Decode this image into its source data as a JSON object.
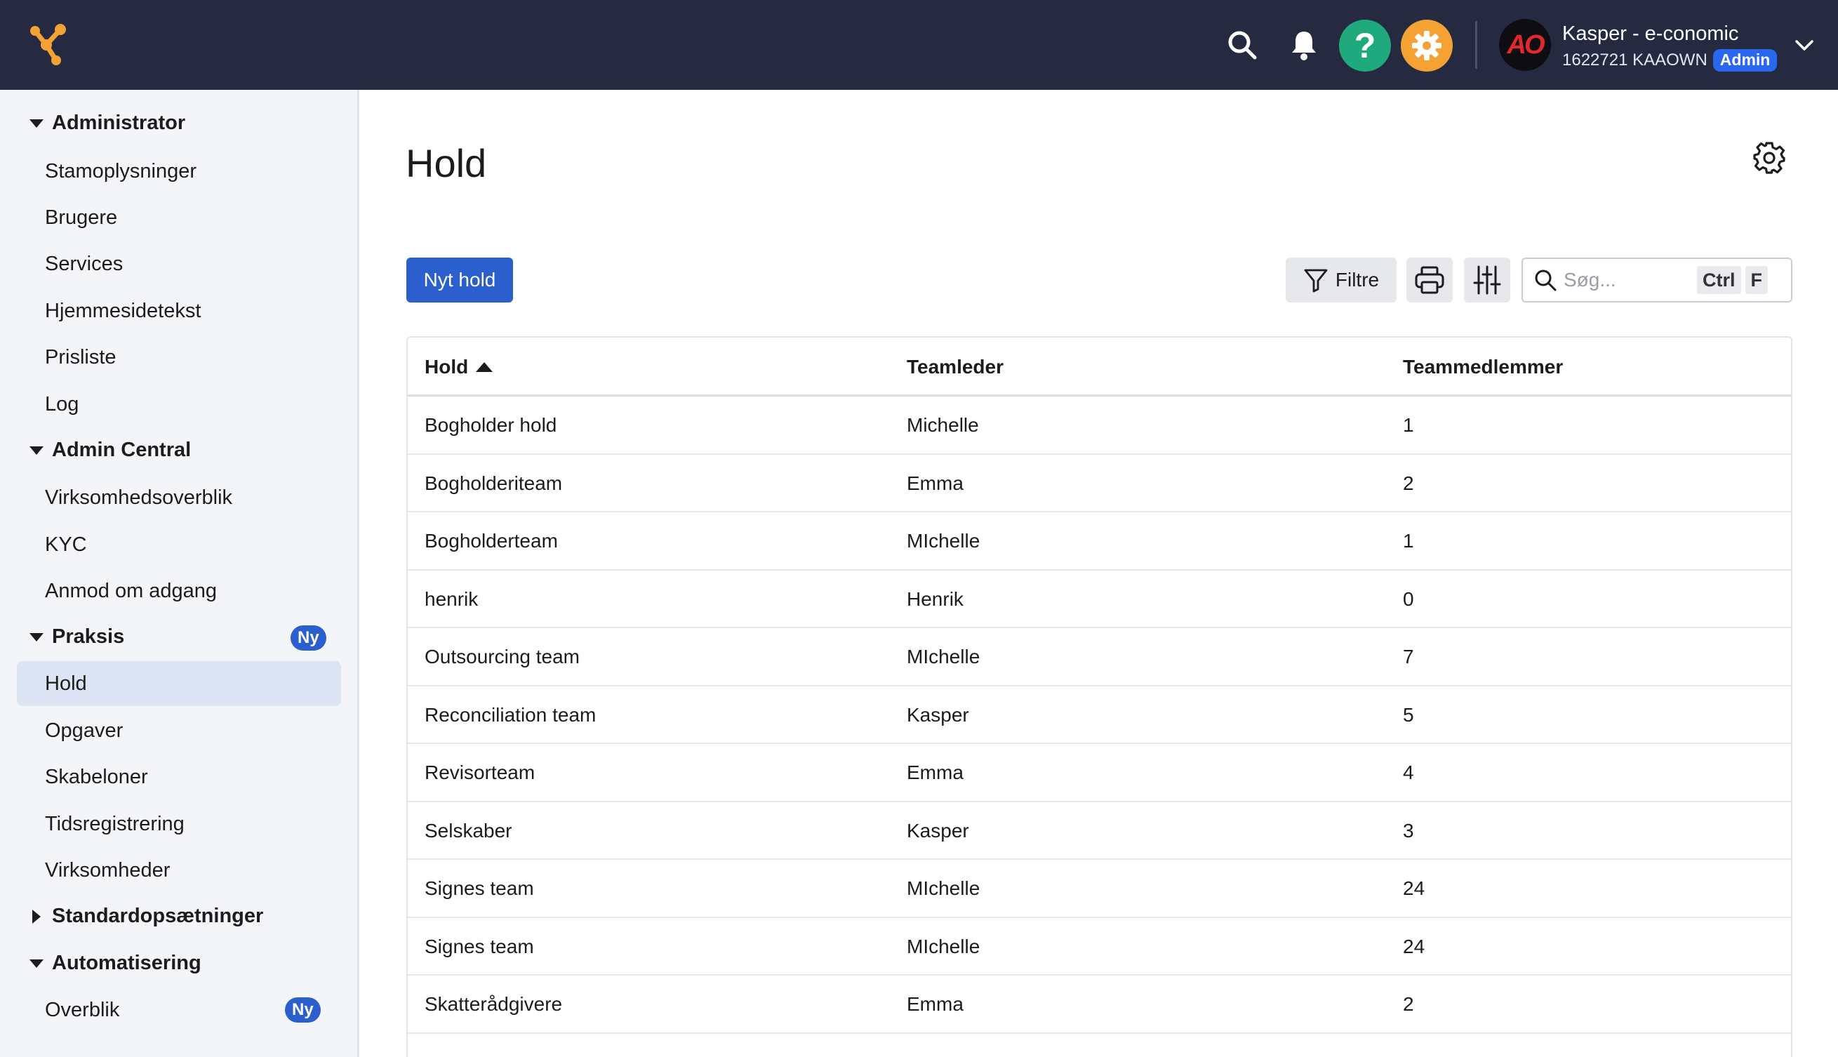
{
  "header": {
    "account_name": "Kasper - e-conomic",
    "account_id": "1622721 KAAOWN",
    "role_badge": "Admin",
    "avatar_text": "AO",
    "help_symbol": "?"
  },
  "sidebar": {
    "groups": [
      {
        "label": "Administrator",
        "expanded": true,
        "items": [
          "Stamoplysninger",
          "Brugere",
          "Services",
          "Hjemmesidetekst",
          "Prisliste",
          "Log"
        ]
      },
      {
        "label": "Admin Central",
        "expanded": true,
        "items": [
          "Virksomhedsoverblik",
          "KYC",
          "Anmod om adgang"
        ]
      },
      {
        "label": "Praksis",
        "expanded": true,
        "badge": "Ny",
        "items": [
          "Hold",
          "Opgaver",
          "Skabeloner",
          "Tidsregistrering",
          "Virksomheder"
        ]
      },
      {
        "label": "Standardopsætninger",
        "expanded": false,
        "items": []
      },
      {
        "label": "Automatisering",
        "expanded": true,
        "items": [
          "Overblik"
        ],
        "item_badge": "Ny"
      }
    ],
    "active_item": "Hold"
  },
  "main": {
    "title": "Hold",
    "new_button": "Nyt hold",
    "filter_button": "Filtre",
    "search_placeholder": "Søg...",
    "shortcut_ctrl": "Ctrl",
    "shortcut_key": "F"
  },
  "table": {
    "columns": [
      "Hold",
      "Teamleder",
      "Teammedlemmer"
    ],
    "sort_column": "Hold",
    "sort_direction": "ascending",
    "rows": [
      [
        "Bogholder hold",
        "Michelle",
        "1"
      ],
      [
        "Bogholderiteam",
        "Emma",
        "2"
      ],
      [
        "Bogholderteam",
        "MIchelle",
        "1"
      ],
      [
        "henrik",
        "Henrik",
        "0"
      ],
      [
        "Outsourcing team",
        "MIchelle",
        "7"
      ],
      [
        "Reconciliation team",
        "Kasper",
        "5"
      ],
      [
        "Revisorteam",
        "Emma",
        "4"
      ],
      [
        "Selskaber",
        "Kasper",
        "3"
      ],
      [
        "Signes team",
        "MIchelle",
        "24"
      ],
      [
        "Signes team",
        "MIchelle",
        "24"
      ],
      [
        "Skatterådgivere",
        "Emma",
        "2"
      ]
    ]
  },
  "colors": {
    "topbar": "#262a41",
    "primary": "#2b5fce",
    "help": "#1faa7e",
    "settings": "#f4a234",
    "active_nav": "#dde4f4"
  }
}
